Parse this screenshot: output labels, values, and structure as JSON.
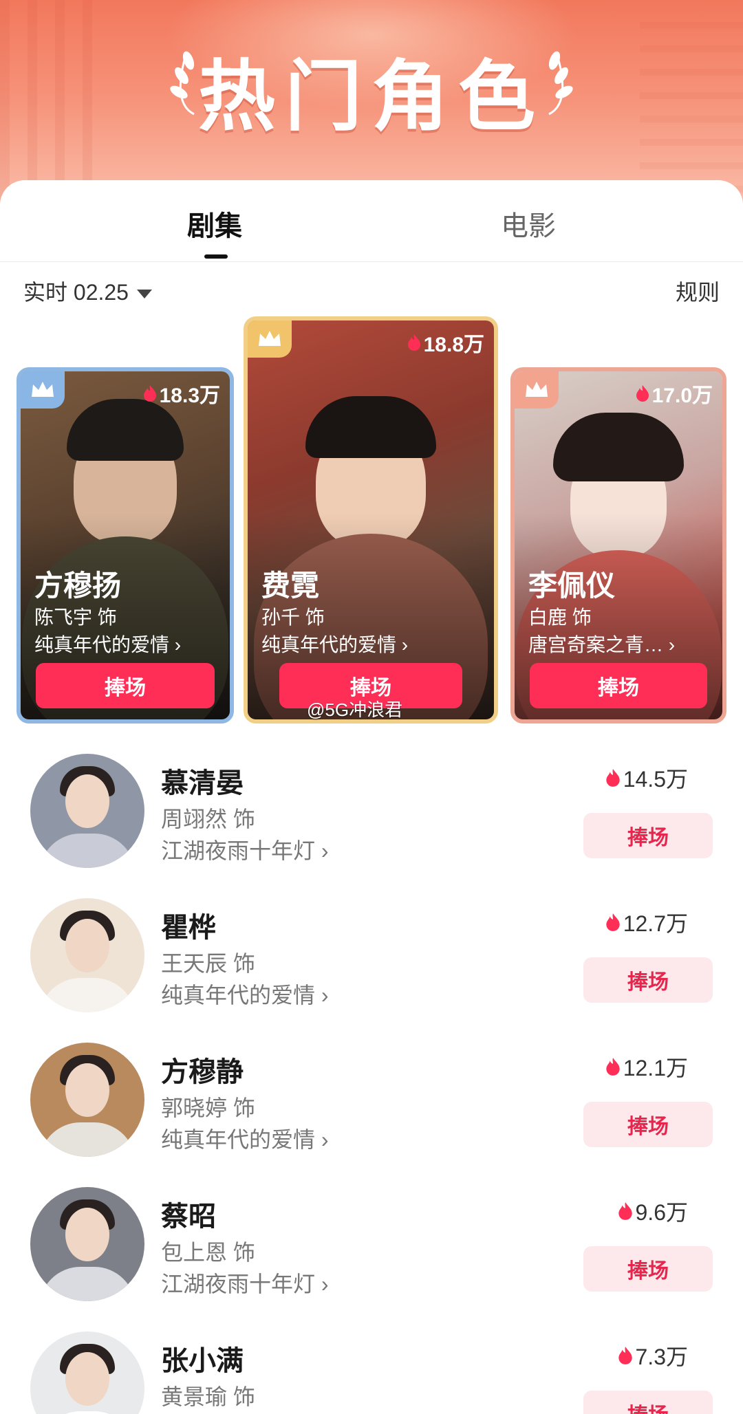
{
  "header": {
    "title": "热门角色"
  },
  "tabs": [
    {
      "label": "剧集",
      "active": true
    },
    {
      "label": "电影",
      "active": false
    }
  ],
  "filter": {
    "date_label": "实时 02.25",
    "rules_label": "规则"
  },
  "podium": [
    {
      "rank": 1,
      "heat": "18.8万",
      "name": "费霓",
      "actor": "孙千 饰",
      "show": "纯真年代的爱情 ›",
      "button": "捧场"
    },
    {
      "rank": 2,
      "heat": "18.3万",
      "name": "方穆扬",
      "actor": "陈飞宇 饰",
      "show": "纯真年代的爱情 ›",
      "button": "捧场"
    },
    {
      "rank": 3,
      "heat": "17.0万",
      "name": "李佩仪",
      "actor": "白鹿 饰",
      "show": "唐宫奇案之青… ›",
      "button": "捧场"
    }
  ],
  "watermark": "@5G冲浪君",
  "list": [
    {
      "name": "慕清晏",
      "actor": "周翊然 饰",
      "show": "江湖夜雨十年灯 ›",
      "heat": "14.5万",
      "button": "捧场"
    },
    {
      "name": "瞿桦",
      "actor": "王天辰 饰",
      "show": "纯真年代的爱情 ›",
      "heat": "12.7万",
      "button": "捧场"
    },
    {
      "name": "方穆静",
      "actor": "郭晓婷 饰",
      "show": "纯真年代的爱情 ›",
      "heat": "12.1万",
      "button": "捧场"
    },
    {
      "name": "蔡昭",
      "actor": "包上恩 饰",
      "show": "江湖夜雨十年灯 ›",
      "heat": "9.6万",
      "button": "捧场"
    },
    {
      "name": "张小满",
      "actor": "黄景瑜 饰",
      "show": "",
      "heat": "7.3万",
      "button": "捧场"
    }
  ],
  "colors": {
    "accent": "#ff2e57",
    "gold": "#f1c36a",
    "silver_blue": "#8ab6e6",
    "bronze": "#f2a48f",
    "soft_button": "#fde8ec"
  },
  "icons": {
    "crown": "crown-icon",
    "fire": "fire-icon",
    "caret": "caret-down-icon",
    "laurel": "laurel-icon"
  }
}
